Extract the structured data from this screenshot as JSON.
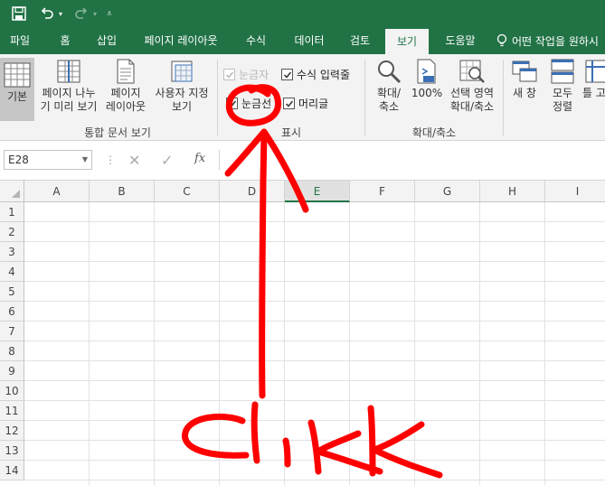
{
  "titlebar": {
    "bg_color": "#217346"
  },
  "tabs": [
    {
      "label": "파일",
      "active": false
    },
    {
      "label": "홈",
      "active": false
    },
    {
      "label": "삽입",
      "active": false
    },
    {
      "label": "페이지 레이아웃",
      "active": false
    },
    {
      "label": "수식",
      "active": false
    },
    {
      "label": "데이터",
      "active": false
    },
    {
      "label": "검토",
      "active": false
    },
    {
      "label": "보기",
      "active": true
    },
    {
      "label": "도움말",
      "active": false
    }
  ],
  "tell_me": "어떤 작업을 원하시",
  "ribbon": {
    "workbook_views": {
      "buttons": [
        {
          "label_1": "기본",
          "label_2": ""
        },
        {
          "label_1": "페이지 나누",
          "label_2": "기 미리 보기"
        },
        {
          "label_1": "페이지",
          "label_2": "레이아웃"
        },
        {
          "label_1": "사용자 지정",
          "label_2": "보기"
        }
      ],
      "group_label": "통합 문서 보기"
    },
    "show": {
      "ruler": {
        "label": "눈금자",
        "checked": true,
        "disabled": true
      },
      "formula_bar": {
        "label": "수식 입력줄",
        "checked": true
      },
      "gridlines": {
        "label": "눈금선",
        "checked": true
      },
      "headings": {
        "label": "머리글",
        "checked": true
      },
      "group_label": "표시"
    },
    "zoom": {
      "zoom_btn": {
        "label_1": "확대/",
        "label_2": "축소"
      },
      "zoom100": {
        "label_1": "100%"
      },
      "zoom_sel": {
        "label_1": "선택 영역",
        "label_2": "확대/축소"
      },
      "group_label": "확대/축소"
    },
    "window": {
      "new_window": {
        "label_1": "새 창"
      },
      "arrange_all": {
        "label_1": "모두",
        "label_2": "정렬"
      },
      "freeze": {
        "label_1": "틀 고"
      }
    }
  },
  "formula_bar": {
    "name_box": "E28",
    "fx": "fx",
    "formula": ""
  },
  "columns": [
    "A",
    "B",
    "C",
    "D",
    "E",
    "F",
    "G",
    "H",
    "I"
  ],
  "selected_column": "E",
  "rows": [
    "1",
    "2",
    "3",
    "4",
    "5",
    "6",
    "7",
    "8",
    "9",
    "10",
    "11",
    "12",
    "13",
    "14"
  ],
  "annotation": {
    "text": "CliK",
    "color": "#ff0000"
  }
}
